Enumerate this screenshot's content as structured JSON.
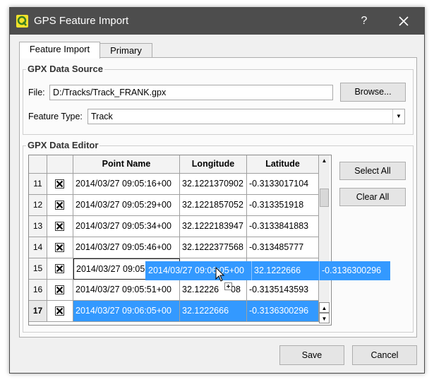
{
  "window": {
    "title": "GPS Feature Import",
    "help_label": "?",
    "icons": {
      "app": "qgis-icon",
      "close": "close-icon"
    }
  },
  "tabs": [
    {
      "label": "Feature Import",
      "active": true
    },
    {
      "label": "Primary",
      "active": false
    }
  ],
  "source": {
    "group_title": "GPX Data Source",
    "file_label": "File:",
    "file_value": "D:/Tracks/Track_FRANK.gpx",
    "browse_label": "Browse...",
    "feature_type_label": "Feature Type:",
    "feature_type_value": "Track"
  },
  "editor": {
    "group_title": "GPX Data Editor",
    "columns": [
      "Point Name",
      "Longitude",
      "Latitude"
    ],
    "rows": [
      {
        "num": "11",
        "checked": true,
        "name": "2014/03/27 09:05:16+00",
        "lon": "32.1221370902",
        "lat": "-0.3133017104"
      },
      {
        "num": "12",
        "checked": true,
        "name": "2014/03/27 09:05:29+00",
        "lon": "32.1221857052",
        "lat": "-0.313351918"
      },
      {
        "num": "13",
        "checked": true,
        "name": "2014/03/27 09:05:34+00",
        "lon": "32.1222183947",
        "lat": "-0.3133841883"
      },
      {
        "num": "14",
        "checked": true,
        "name": "2014/03/27 09:05:46+00",
        "lon": "32.1222377568",
        "lat": "-0.313485777"
      },
      {
        "num": "15",
        "checked": true,
        "name": "2014/03/27 09:05",
        "lon": "",
        "lat": ""
      },
      {
        "num": "16",
        "checked": true,
        "name": "2014/03/27 09:05:51+00",
        "lon": "32.12226",
        "lat": "-0.3135143593",
        "lon_tail": "08"
      },
      {
        "num": "17",
        "checked": true,
        "name": "2014/03/27 09:06:05+00",
        "lon": "32.1222666",
        "lat": "-0.3136300296",
        "selected": true
      }
    ],
    "drag_ghost": {
      "name": "2014/03/27 09:06:05+00",
      "lon": "32.1222666",
      "lat": "-0.3136300296"
    },
    "select_all_label": "Select All",
    "clear_all_label": "Clear All"
  },
  "footer": {
    "save_label": "Save",
    "cancel_label": "Cancel"
  }
}
